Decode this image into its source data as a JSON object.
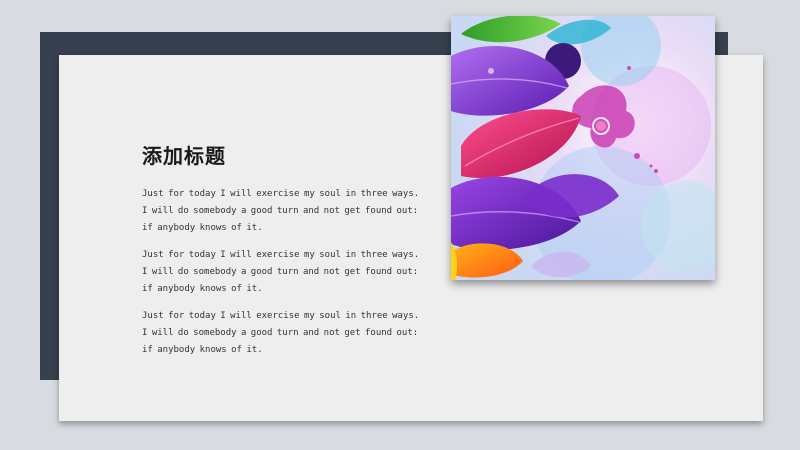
{
  "slide": {
    "title": "添加标题",
    "paragraphs": [
      "Just for today I will exercise my soul in three ways. I will do somebody a good turn and not get found out: if anybody knows of it.",
      "Just for today I will exercise my soul in three ways. I will do somebody a good turn and not get found out: if anybody knows of it.",
      "Just for today I will exercise my soul in three ways. I will do somebody a good turn and not get found out: if anybody knows of it."
    ]
  },
  "colors": {
    "background": "#d8dce0",
    "back_panel": "#36404e",
    "card": "#eeeeee",
    "title_text": "#1a1a1a",
    "body_text": "#333333",
    "leaf_purple": "#8a2fd6",
    "leaf_magenta": "#d6206e",
    "leaf_green": "#4cbf3a",
    "leaf_orange": "#ff7a1a"
  },
  "image": {
    "icon": "colorful-leaves-illustration"
  }
}
